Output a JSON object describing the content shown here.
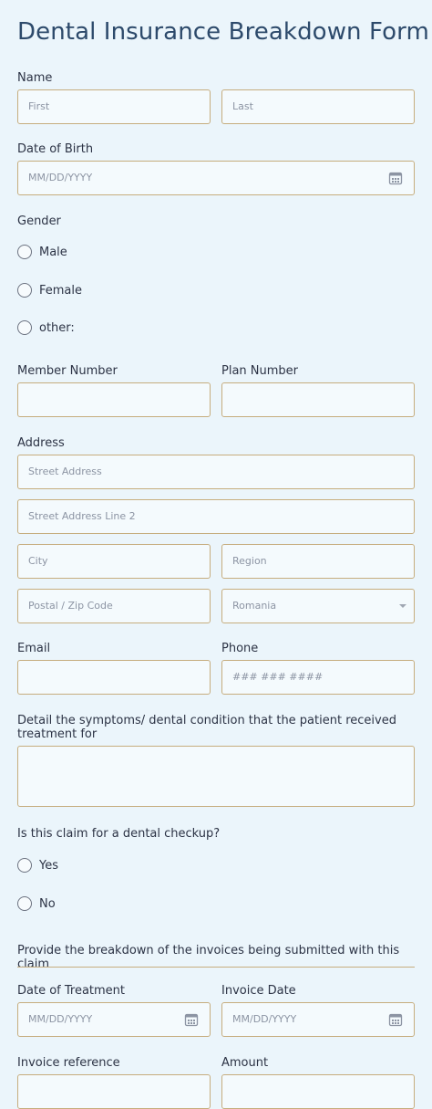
{
  "title": "Dental Insurance Breakdown Form",
  "name": {
    "label": "Name",
    "first_placeholder": "First",
    "last_placeholder": "Last"
  },
  "dob": {
    "label": "Date of Birth",
    "placeholder": "MM/DD/YYYY"
  },
  "gender": {
    "label": "Gender",
    "options": [
      "Male",
      "Female",
      "other:"
    ]
  },
  "member_number": {
    "label": "Member Number"
  },
  "plan_number": {
    "label": "Plan Number"
  },
  "address": {
    "label": "Address",
    "street_placeholder": "Street Address",
    "street2_placeholder": "Street Address Line 2",
    "city_placeholder": "City",
    "region_placeholder": "Region",
    "postal_placeholder": "Postal / Zip Code",
    "country_value": "Romania"
  },
  "email": {
    "label": "Email"
  },
  "phone": {
    "label": "Phone",
    "placeholder": "### ### ####"
  },
  "symptoms": {
    "label": "Detail the symptoms/ dental condition that the patient received treatment for"
  },
  "checkup": {
    "label": "Is this claim for a dental checkup?",
    "options": [
      "Yes",
      "No"
    ]
  },
  "breakdown": {
    "heading": "Provide the breakdown of the invoices being submitted with this claim"
  },
  "date_of_treatment": {
    "label": "Date of Treatment",
    "placeholder": "MM/DD/YYYY"
  },
  "invoice_date": {
    "label": "Invoice Date",
    "placeholder": "MM/DD/YYYY"
  },
  "invoice_reference": {
    "label": "Invoice reference"
  },
  "amount": {
    "label": "Amount"
  },
  "colors": {
    "background": "#ebf5fb",
    "field_border": "#c6ad7e",
    "title": "#2d4a6b"
  }
}
